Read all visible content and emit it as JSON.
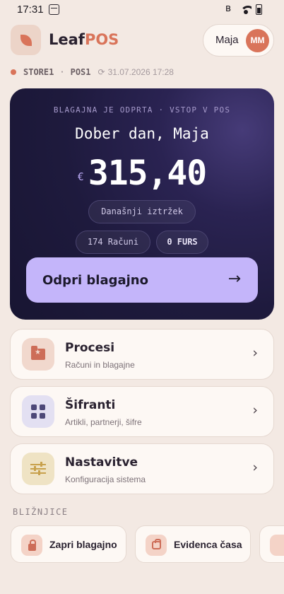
{
  "status_bar": {
    "time": "17:31",
    "icons": [
      "notification-icon",
      "bluetooth-icon",
      "wifi-icon",
      "battery-icon"
    ]
  },
  "header": {
    "brand_part1": "Leaf",
    "brand_part2": "POS",
    "user_name": "Maja",
    "user_initials": "MM"
  },
  "store": {
    "store_name": "STORE1",
    "separator": "·",
    "pos_name": "POS1",
    "sync_icon": "⟳",
    "last_sync": "31.07.2026 17:28"
  },
  "hero": {
    "top_line": "BLAGAJNA JE ODPRTA · VSTOP V POS",
    "greeting": "Dober dan, Maja",
    "currency": "€",
    "amount": "315,40",
    "today_label": "Današnji iztržek",
    "bills_label": "174 Računi",
    "furs_label": "0 FURS",
    "open_button": "Odpri blagajno",
    "open_arrow": "→"
  },
  "menu": [
    {
      "title": "Procesi",
      "subtitle": "Računi in blagajne",
      "icon": "folder-star-icon"
    },
    {
      "title": "Šifranti",
      "subtitle": "Artikli, partnerji, šifre",
      "icon": "grid-icon"
    },
    {
      "title": "Nastavitve",
      "subtitle": "Konfiguracija sistema",
      "icon": "tune-icon"
    }
  ],
  "shortcuts": {
    "label": "BLIŽNJICE",
    "items": [
      {
        "label": "Zapri blagajno",
        "icon": "lock-icon"
      },
      {
        "label": "Evidenca časa",
        "icon": "clock-bag-icon"
      },
      {
        "label": "",
        "icon": ""
      }
    ]
  },
  "colors": {
    "accent": "#d9745a",
    "hero_bg": "#1e1a3d",
    "button_violet": "#c4b5fa",
    "page_bg": "#f3e9e3"
  }
}
